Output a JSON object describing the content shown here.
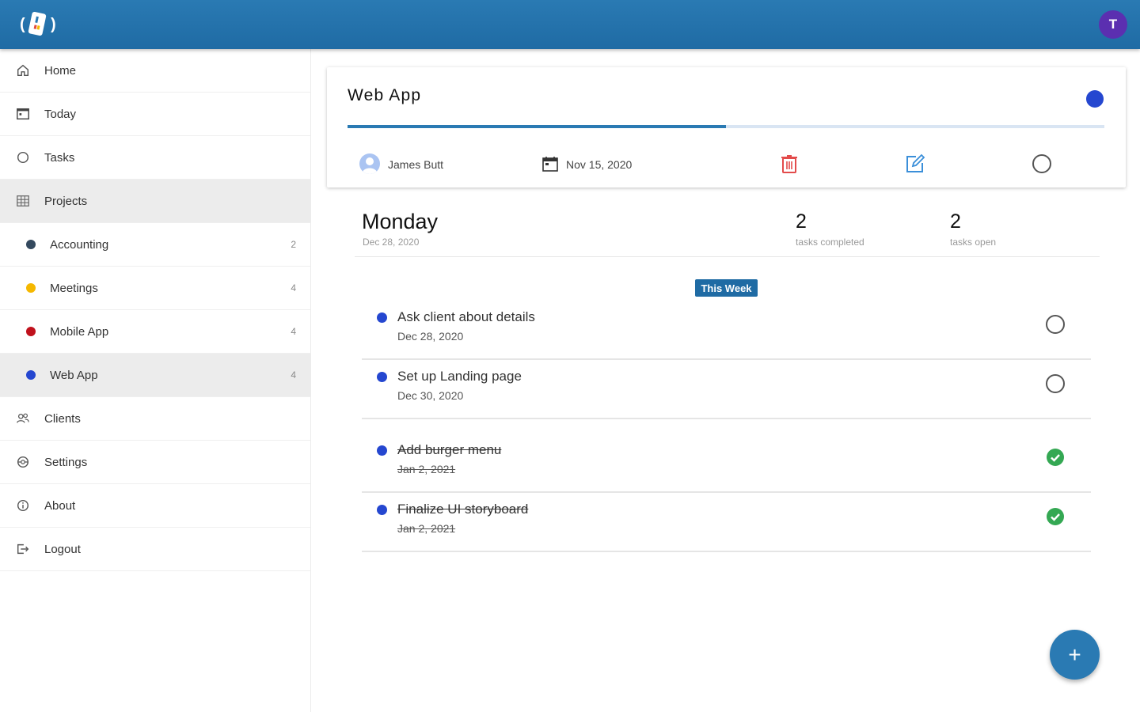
{
  "header": {
    "avatar_initial": "T",
    "avatar_color": "#5b2fb0",
    "bar_color": "#2a7ab3"
  },
  "sidebar": {
    "items": [
      {
        "label": "Home",
        "icon": "home-icon"
      },
      {
        "label": "Today",
        "icon": "calendar-icon"
      },
      {
        "label": "Tasks",
        "icon": "circle-icon"
      },
      {
        "label": "Projects",
        "icon": "grid-icon"
      },
      {
        "label": "Clients",
        "icon": "people-icon"
      },
      {
        "label": "Settings",
        "icon": "gear-icon"
      },
      {
        "label": "About",
        "icon": "info-icon"
      },
      {
        "label": "Logout",
        "icon": "logout-icon"
      }
    ],
    "projects": [
      {
        "label": "Accounting",
        "count": "2",
        "color": "#34495e"
      },
      {
        "label": "Meetings",
        "count": "4",
        "color": "#f5b800"
      },
      {
        "label": "Mobile App",
        "count": "4",
        "color": "#c0111c"
      },
      {
        "label": "Web App",
        "count": "4",
        "color": "#2547d0"
      }
    ]
  },
  "project": {
    "title": "Web App",
    "color": "#2547d0",
    "progress_fraction": 0.5,
    "owner": "James Butt",
    "date": "Nov 15, 2020"
  },
  "summary": {
    "day": "Monday",
    "date": "Dec 28, 2020",
    "completed_count": "2",
    "completed_label": "tasks completed",
    "open_count": "2",
    "open_label": "tasks open"
  },
  "week_badge": "This Week",
  "tasks": [
    {
      "name": "Ask client about details",
      "date": "Dec 28, 2020",
      "done": false
    },
    {
      "name": "Set up Landing page",
      "date": "Dec 30, 2020",
      "done": false
    },
    {
      "name": "Add burger menu",
      "date": "Jan 2, 2021",
      "done": true
    },
    {
      "name": "Finalize UI storyboard",
      "date": "Jan 2, 2021",
      "done": true
    }
  ],
  "fab_label": "+"
}
